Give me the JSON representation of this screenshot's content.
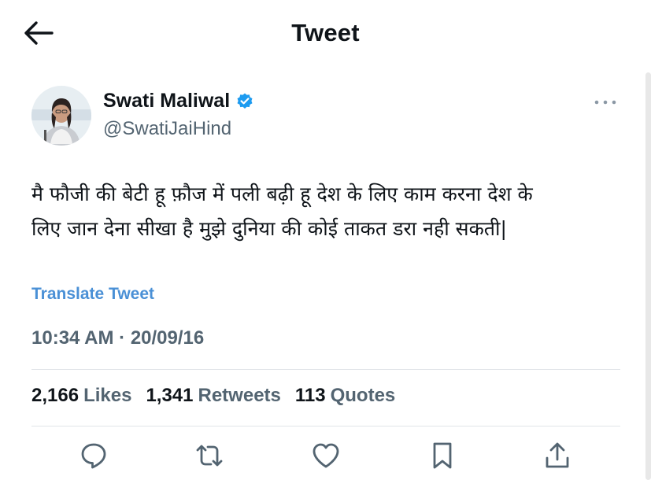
{
  "header": {
    "title": "Tweet",
    "back_icon": "arrow-left-icon"
  },
  "tweet": {
    "author_name": "Swati Maliwal",
    "author_handle": "@SwatiJaiHind",
    "verified": true,
    "text_lines": [
      "मै फौजी की बेटी हू फ़ौज में पली बढ़ी हू देश के लिए काम करना देश के",
      "लिए जान देना सीखा है मुझे दुनिया की कोई ताकत डरा नही सकती|"
    ],
    "translate_label": "Translate Tweet",
    "timestamp": "10:34 AM · 20/09/16"
  },
  "stats": {
    "likes_count": "2,166",
    "likes_label": "Likes",
    "retweets_count": "1,341",
    "retweets_label": "Retweets",
    "quotes_count": "113",
    "quotes_label": "Quotes"
  },
  "icons": {
    "reply": "reply-icon",
    "retweet": "retweet-icon",
    "like": "heart-icon",
    "bookmark": "bookmark-icon",
    "share": "share-icon",
    "more": "more-icon"
  },
  "colors": {
    "link": "#4a90d6",
    "verified": "#1d9bf0",
    "secondary_text": "#536471"
  }
}
